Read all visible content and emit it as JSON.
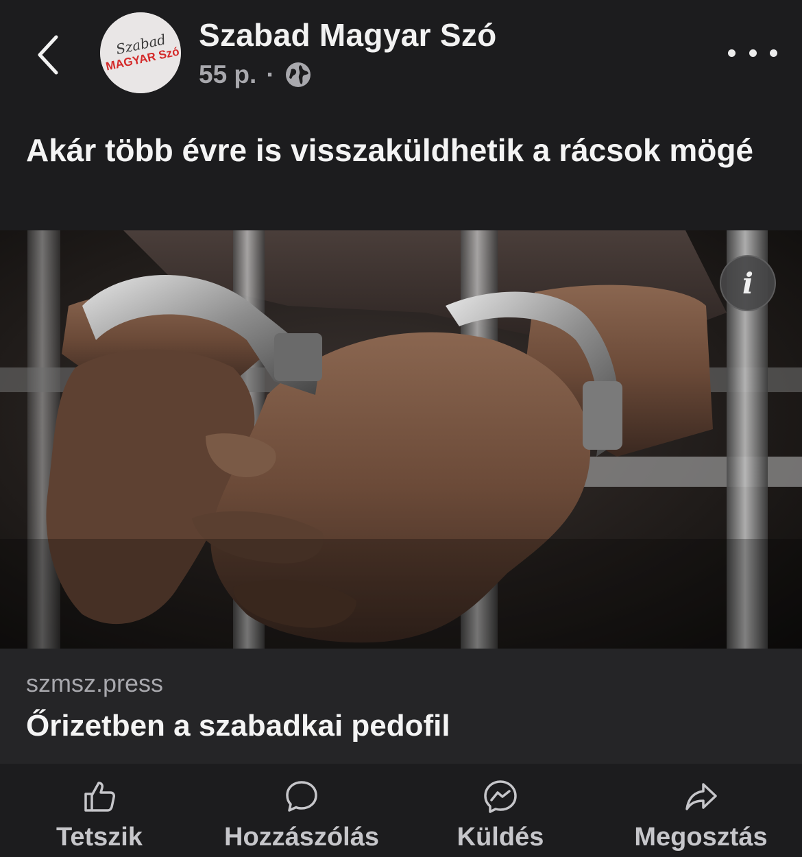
{
  "header": {
    "back_icon": "chevron-left-icon",
    "page_name": "Szabad Magyar Szó",
    "avatar_logo_text_top": "Szabad",
    "avatar_logo_text_bottom": "MAGYAR Szó",
    "time_ago": "55 p.",
    "separator": "·",
    "audience_icon": "globe-icon",
    "more_icon": "more-horizontal-icon"
  },
  "post": {
    "text": "Akár több évre is visszaküldhetik a rácsok mögé"
  },
  "image": {
    "description_icon": "info-icon",
    "info_symbol": "i"
  },
  "link_preview": {
    "domain": "szmsz.press",
    "title": "Őrizetben a szabadkai pedofil"
  },
  "actions": [
    {
      "label": "Tetszik",
      "icon": "thumbs-up-icon"
    },
    {
      "label": "Hozzászólás",
      "icon": "comment-icon"
    },
    {
      "label": "Küldés",
      "icon": "messenger-icon"
    },
    {
      "label": "Megosztás",
      "icon": "share-icon"
    }
  ],
  "colors": {
    "background": "#1c1c1e",
    "preview_background": "#252527",
    "secondary_text": "#a8a8ad",
    "logo_red": "#d42a2a"
  }
}
